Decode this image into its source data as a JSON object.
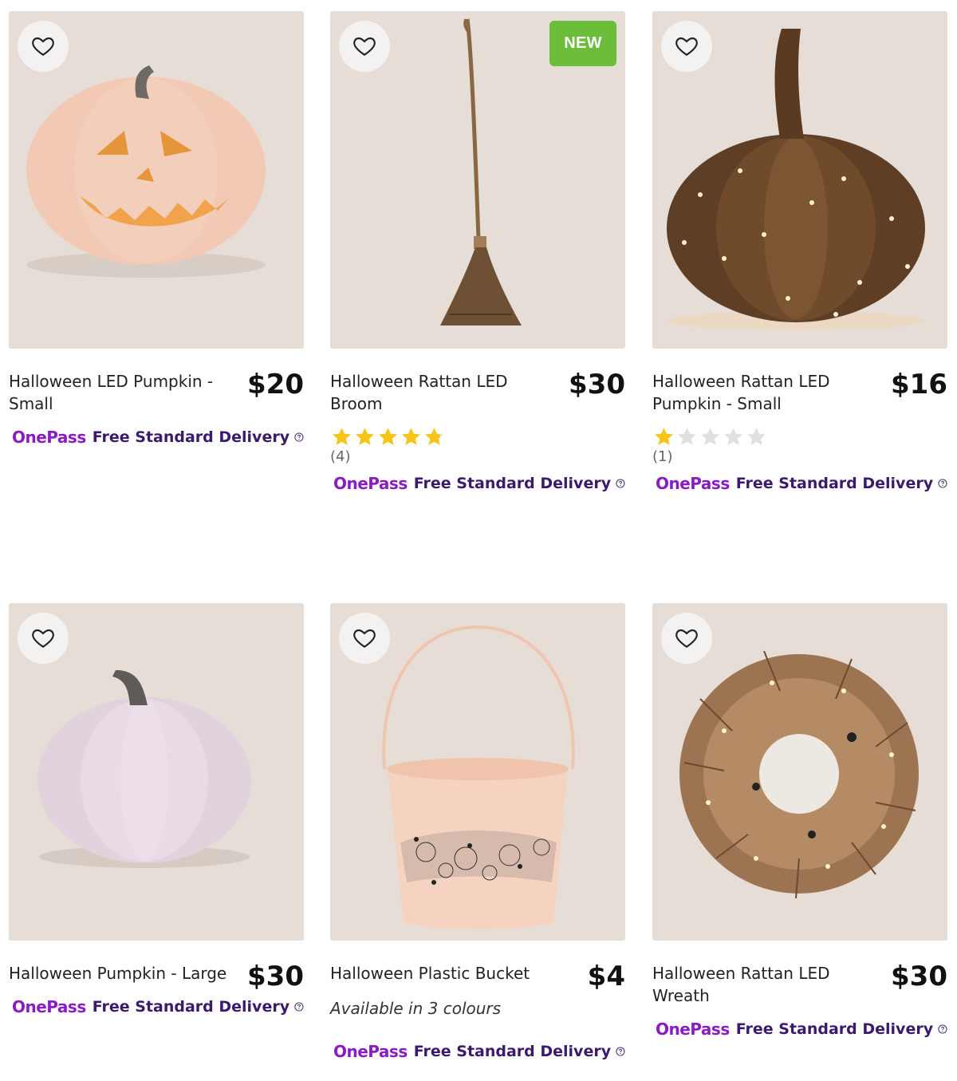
{
  "products": [
    {
      "title": "Halloween LED Pumpkin - Small",
      "price": "$20",
      "badge": "",
      "rating": null,
      "reviews": "",
      "colours_note": "",
      "delivery_brand": "OnePass",
      "delivery_text": "Free Standard Delivery",
      "image_icon": "jack-o-lantern-image"
    },
    {
      "title": "Halloween Rattan LED Broom",
      "price": "$30",
      "badge": "NEW",
      "rating": 4.8,
      "reviews": "(4)",
      "colours_note": "",
      "delivery_brand": "OnePass",
      "delivery_text": "Free Standard Delivery",
      "image_icon": "broom-image"
    },
    {
      "title": "Halloween Rattan LED Pumpkin - Small",
      "price": "$16",
      "badge": "",
      "rating": 1,
      "reviews": "(1)",
      "colours_note": "",
      "delivery_brand": "OnePass",
      "delivery_text": "Free Standard Delivery",
      "image_icon": "rattan-pumpkin-image"
    },
    {
      "title": "Halloween Pumpkin - Large",
      "price": "$30",
      "badge": "",
      "rating": null,
      "reviews": "",
      "colours_note": "",
      "delivery_brand": "OnePass",
      "delivery_text": "Free Standard Delivery",
      "image_icon": "white-pumpkin-image"
    },
    {
      "title": "Halloween Plastic Bucket",
      "price": "$4",
      "badge": "",
      "rating": null,
      "reviews": "",
      "colours_note": "Available in 3 colours",
      "delivery_brand": "OnePass",
      "delivery_text": "Free Standard Delivery",
      "image_icon": "bucket-image"
    },
    {
      "title": "Halloween Rattan LED Wreath",
      "price": "$30",
      "badge": "",
      "rating": null,
      "reviews": "",
      "colours_note": "",
      "delivery_brand": "OnePass",
      "delivery_text": "Free Standard Delivery",
      "image_icon": "wreath-image"
    }
  ],
  "colors": {
    "image_background": "#e6ddd6",
    "star_filled": "#f5c518",
    "star_empty": "#e0e0e0",
    "onepass_brand": "#8a1cc4",
    "delivery_text": "#3b1a6e",
    "new_badge": "#6bbd3a"
  }
}
